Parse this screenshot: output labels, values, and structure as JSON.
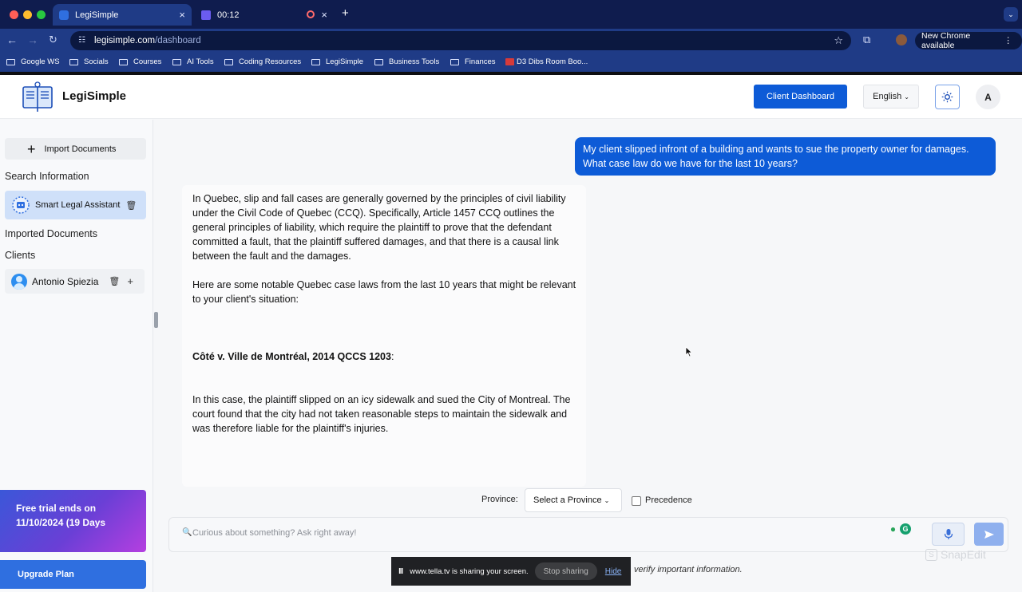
{
  "browser": {
    "tabs": [
      {
        "title": "LegiSimple"
      },
      {
        "title": "00:12"
      }
    ],
    "url_host": "legisimple.com",
    "url_path": "/dashboard",
    "new_chrome_label": "New Chrome available",
    "bookmarks": [
      "Google WS",
      "Socials",
      "Courses",
      "AI Tools",
      "Coding Resources",
      "LegiSimple",
      "Business Tools",
      "Finances",
      "D3 Dibs Room Boo..."
    ]
  },
  "header": {
    "brand": "LegiSimple",
    "client_dashboard_label": "Client Dashboard",
    "language": "English",
    "avatar_initial": "A"
  },
  "sidebar": {
    "import_label": "Import Documents",
    "search_info_label": "Search Information",
    "smart_assistant_label": "Smart Legal Assistant",
    "imported_docs_label": "Imported Documents",
    "clients_label": "Clients",
    "client_name": "Antonio Spiezia",
    "trial_line1": "Free trial ends on",
    "trial_line2": "11/10/2024 (19 Days",
    "upgrade_label": "Upgrade Plan"
  },
  "chat": {
    "user_message": "My client slipped infront of a building and wants to sue the property owner for damages. What case law do we have for the last 10 years?",
    "ai_intro": "In Quebec, slip and fall cases are generally governed by the principles of civil liability under the Civil Code of Quebec (CCQ). Specifically, Article 1457 CCQ outlines the general principles of liability, which require the plaintiff to prove that the defendant committed a fault, that the plaintiff suffered damages, and that there is a causal link between the fault and the damages.",
    "ai_lead": "Here are some notable Quebec case laws from the last 10 years that might be relevant to your client's situation:",
    "case_title": "Côté v. Ville de Montréal, 2014 QCCS 1203",
    "case_colon": ":",
    "case_body": "In this case, the plaintiff slipped on an icy sidewalk and sued the City of Montreal. The court found that the city had not taken reasonable steps to maintain the sidewalk and was therefore liable for the plaintiff's injuries."
  },
  "controls": {
    "province_label": "Province:",
    "province_value": "Select a Province",
    "precedence_label": "Precedence",
    "input_placeholder": "Curious about something? Ask right away!",
    "disclaimer": "verify important information."
  },
  "overlay": {
    "share_text": "www.tella.tv is sharing your screen.",
    "stop_sharing": "Stop sharing",
    "hide": "Hide",
    "watermark": "SnapEdit"
  },
  "colors": {
    "brand_blue": "#0d5bd7",
    "chrome_dark": "#0f1c4e",
    "chrome_toolbar": "#1f3b86"
  }
}
